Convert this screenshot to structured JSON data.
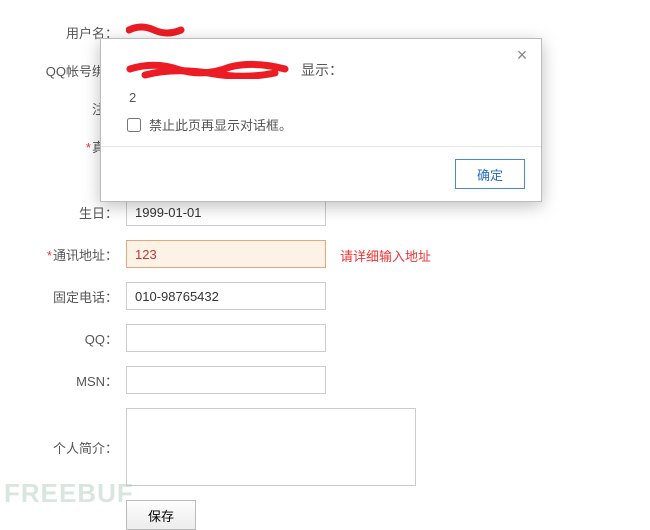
{
  "form": {
    "username": {
      "label": "用户名："
    },
    "qqbind": {
      "label": "QQ帐号绑定"
    },
    "regdate": {
      "label": "注册"
    },
    "realname": {
      "label": "真实",
      "required": "*"
    },
    "birthday": {
      "label": "生日：",
      "value": "1999-01-01"
    },
    "address": {
      "label": "通讯地址：",
      "required": "*",
      "value": "123",
      "error": "请详细输入地址"
    },
    "phone": {
      "label": "固定电话：",
      "value": "010-98765432"
    },
    "qq": {
      "label": "QQ：",
      "value": ""
    },
    "msn": {
      "label": "MSN：",
      "value": ""
    },
    "bio": {
      "label": "个人简介：",
      "value": ""
    },
    "save": {
      "label": "保存"
    }
  },
  "dialog": {
    "says": "显示：",
    "message": "2",
    "suppress_label": "禁止此页再显示对话框。",
    "ok_label": "确定"
  },
  "watermark": "FREEBUF"
}
